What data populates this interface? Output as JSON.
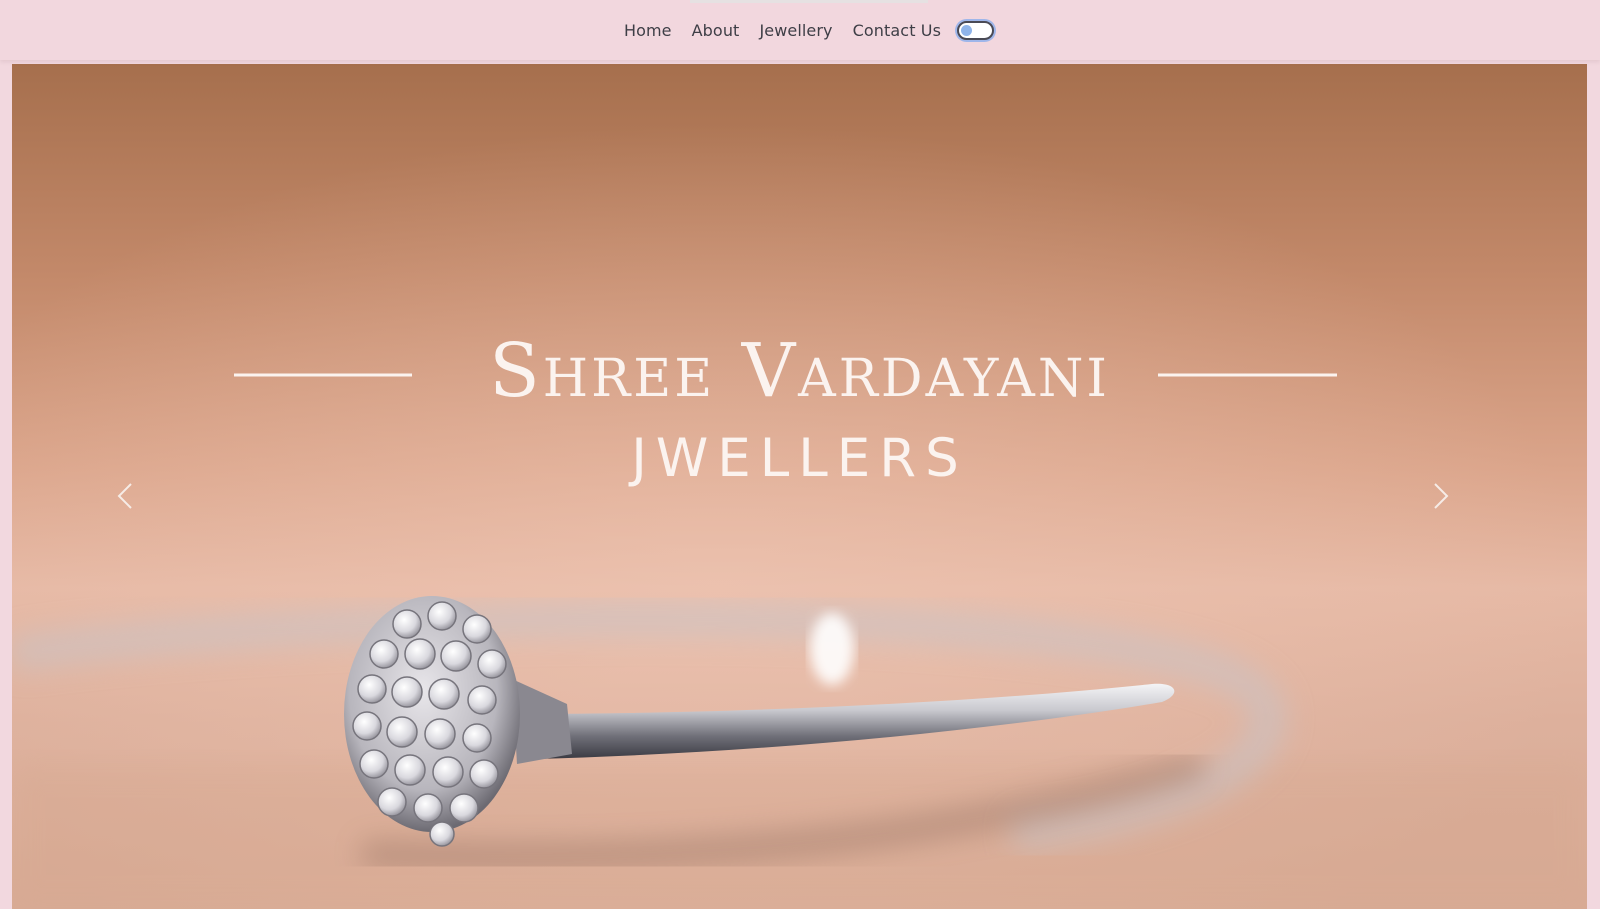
{
  "nav": {
    "items": [
      {
        "label": "Home"
      },
      {
        "label": "About"
      },
      {
        "label": "Jewellery"
      },
      {
        "label": "Contact Us"
      }
    ],
    "theme_toggle": {
      "icon": "toggle-switch",
      "state": "off"
    }
  },
  "hero": {
    "title": "Shree Vardayani",
    "subtitle": "JWELLERS",
    "prev_icon": "chevron-left-icon",
    "next_icon": "chevron-right-icon"
  },
  "colors": {
    "nav_background": "#f2d7de",
    "nav_text": "#3e3e46",
    "hero_text": "#fbf3ef",
    "hero_top": "#a66f4d",
    "hero_bottom": "#d8ab95"
  }
}
